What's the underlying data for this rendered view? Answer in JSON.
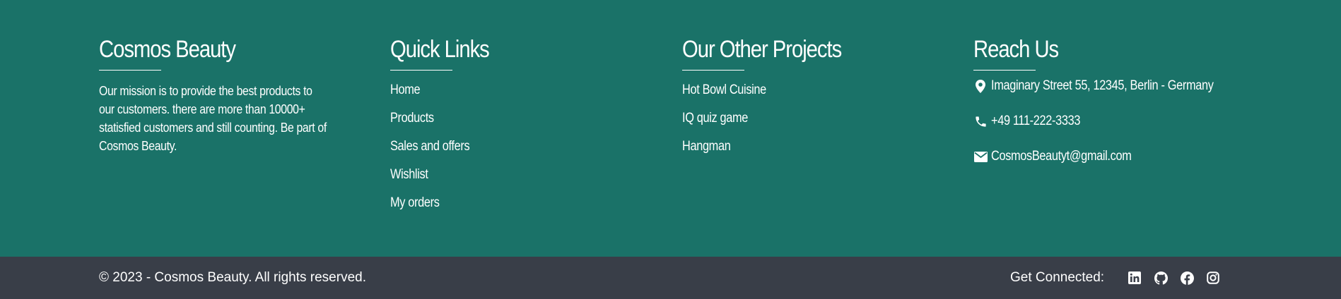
{
  "about": {
    "title": "Cosmos Beauty",
    "text": "Our mission is to provide the best products to our customers. there are more than 10000+ statisfied customers and still counting. Be part of Cosmos Beauty."
  },
  "quick_links": {
    "title": "Quick Links",
    "items": [
      "Home",
      "Products",
      "Sales and offers",
      "Wishlist",
      "My orders"
    ]
  },
  "other_projects": {
    "title": "Our Other Projects",
    "items": [
      "Hot Bowl Cuisine",
      "IQ quiz game",
      "Hangman"
    ]
  },
  "reach_us": {
    "title": "Reach Us",
    "address": "Imaginary Street 55, 12345, Berlin - Germany",
    "phone": "+49 111-222-3333",
    "email": "CosmosBeautyt@gmail.com",
    "icons": [
      "location-pin-icon",
      "phone-icon",
      "envelope-icon"
    ]
  },
  "bottom": {
    "copyright": "© 2023 - Cosmos Beauty. All rights reserved.",
    "connect_label": "Get Connected:",
    "social_icons": [
      "linkedin-icon",
      "github-icon",
      "facebook-icon",
      "instagram-icon"
    ]
  },
  "colors": {
    "footer_bg": "#1a7268",
    "bottom_bar_bg": "#393e48",
    "text": "#ffffff"
  }
}
